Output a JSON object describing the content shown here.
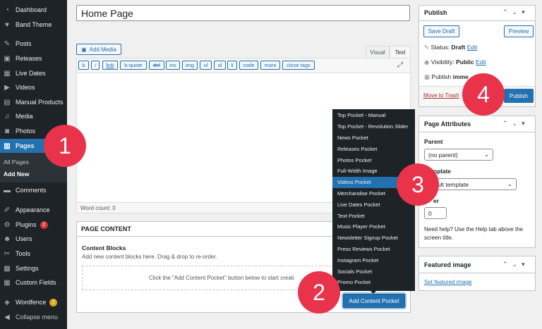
{
  "sidebar": {
    "items": [
      {
        "label": "Dashboard",
        "icon": "dashboard-icon"
      },
      {
        "label": "Band Theme",
        "icon": "heart-icon"
      },
      {
        "label": "Posts",
        "icon": "pin-icon"
      },
      {
        "label": "Releases",
        "icon": "releases-icon"
      },
      {
        "label": "Live Dates",
        "icon": "calendar-icon"
      },
      {
        "label": "Videos",
        "icon": "video-icon"
      },
      {
        "label": "Manual Products",
        "icon": "cart-icon"
      },
      {
        "label": "Media",
        "icon": "media-icon"
      },
      {
        "label": "Photos",
        "icon": "camera-icon"
      },
      {
        "label": "Pages",
        "icon": "pages-icon"
      },
      {
        "label": "Comments",
        "icon": "comment-icon"
      },
      {
        "label": "Appearance",
        "icon": "brush-icon"
      },
      {
        "label": "Plugins",
        "icon": "plugin-icon",
        "badge": "2"
      },
      {
        "label": "Users",
        "icon": "users-icon"
      },
      {
        "label": "Tools",
        "icon": "wrench-icon"
      },
      {
        "label": "Settings",
        "icon": "settings-icon"
      },
      {
        "label": "Custom Fields",
        "icon": "fields-icon"
      },
      {
        "label": "Wordfence",
        "icon": "shield-icon",
        "badge": "2"
      },
      {
        "label": "Collapse menu",
        "icon": "collapse-icon"
      }
    ],
    "submenu": [
      "All Pages",
      "Add New"
    ],
    "colors": {
      "bg": "#1d2327",
      "active": "#2271b1",
      "badge_red": "#d63638",
      "badge_yellow": "#dba617"
    }
  },
  "editor": {
    "title_value": "Home Page",
    "add_media": "Add Media",
    "tab_visual": "Visual",
    "tab_text": "Text",
    "quicktags": [
      "b",
      "i",
      "link",
      "b-quote",
      "del",
      "ins",
      "img",
      "ul",
      "ol",
      "li",
      "code",
      "more",
      "close tags"
    ],
    "word_count": "Word count: 0"
  },
  "page_content": {
    "header": "PAGE CONTENT",
    "blocks_title": "Content Blocks",
    "blocks_desc": "Add new content blocks here. Drag & drop to re-order.",
    "placeholder": "Click the \"Add Content Pocket\" button below to start creati",
    "add_button": "Add Content Pocket"
  },
  "pocket_menu": {
    "items": [
      "Top Pocket - Manual",
      "Top Pocket - Revolution Slider",
      "News Pocket",
      "Releases Pocket",
      "Photos Pocket",
      "Full-Width Image",
      "Videos Pocket",
      "Merchandise Pocket",
      "Live Dates Pocket",
      "Text Pocket",
      "Music Player Pocket",
      "Newsletter Signup Pocket",
      "Press Reviews Pocket",
      "Instagram Pocket",
      "Socials Pocket",
      "Promo Pocket"
    ],
    "active": "Videos Pocket"
  },
  "publish": {
    "title": "Publish",
    "save_draft": "Save Draft",
    "preview": "Preview",
    "status_label": "Status:",
    "status_value": "Draft",
    "status_edit": "Edit",
    "visibility_label": "Visibility:",
    "visibility_value": "Public",
    "visibility_edit": "Edit",
    "publish_label": "Publish",
    "publish_value": "imme",
    "move_trash": "Move to Trash",
    "publish_button": "Publish"
  },
  "page_attributes": {
    "title": "Page Attributes",
    "parent_label": "Parent",
    "parent_value": "(no parent)",
    "template_label": "nplate",
    "template_value": "ult template",
    "order_label": "er",
    "order_value": "0",
    "help_text": "Need help? Use the Help tab above the screen title."
  },
  "featured_image": {
    "title": "Featured image",
    "link": "Set featured image"
  },
  "callouts": [
    "1",
    "2",
    "3",
    "4"
  ]
}
